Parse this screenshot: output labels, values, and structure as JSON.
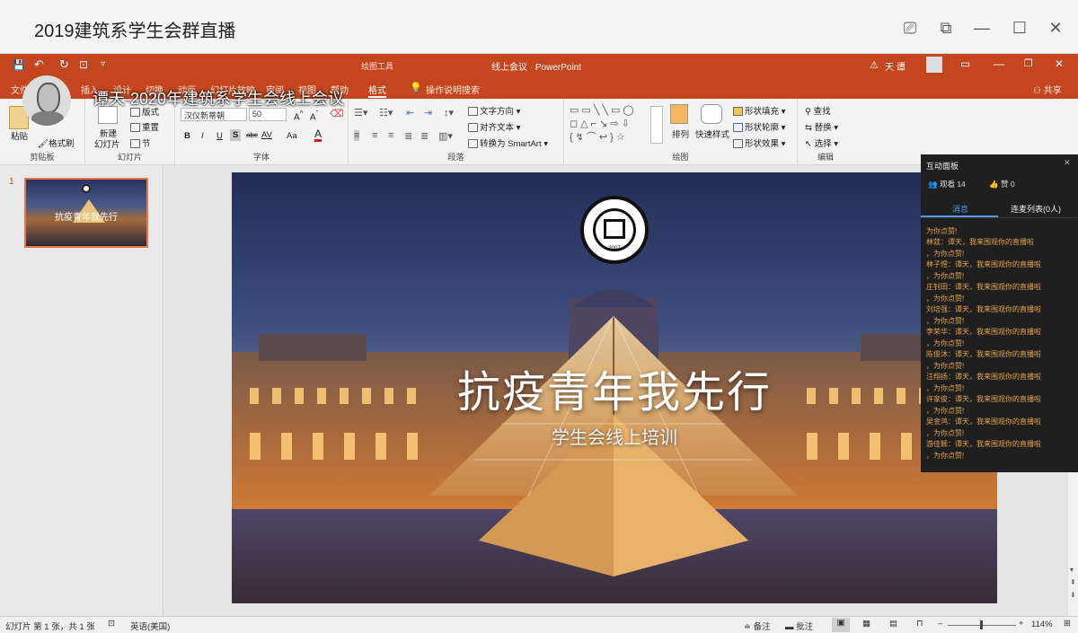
{
  "window": {
    "title": "2019建筑系学生会群直播"
  },
  "ppt": {
    "doc_title": "线上会议 · PowerPoint",
    "drawing_tools": "绘图工具",
    "user": "天 谭",
    "share": "共享",
    "tabs": [
      "文件",
      "插入",
      "设计",
      "切换",
      "动画",
      "幻灯片放映",
      "审阅",
      "视图",
      "帮助",
      "格式"
    ],
    "tell_me": "操作说明搜索"
  },
  "ribbon": {
    "clipboard": {
      "label": "剪贴板",
      "paste": "粘贴",
      "format_painter": "格式刷"
    },
    "slides": {
      "label": "幻灯片",
      "new_slide_line1": "新建",
      "new_slide_line2": "幻灯片",
      "layout": "版式",
      "reset": "重置",
      "section": "节"
    },
    "font": {
      "label": "字体",
      "font_name": "汉仪新蒂朝",
      "font_size": "50",
      "bold": "B",
      "italic": "I",
      "underline": "U",
      "shadow": "S",
      "strike": "abc",
      "spacing": "AV",
      "case": "Aa",
      "color": "A"
    },
    "paragraph": {
      "label": "段落",
      "text_direction": "文字方向",
      "align_text": "对齐文本",
      "smartart": "转换为 SmartArt"
    },
    "drawing": {
      "label": "绘图",
      "arrange": "排列",
      "quick_styles": "快速样式",
      "fill": "形状填充",
      "outline": "形状轮廓",
      "effects": "形状效果"
    },
    "editing": {
      "label": "编辑",
      "find": "查找",
      "replace": "替换",
      "select": "选择"
    }
  },
  "thumbnail": {
    "number": "1",
    "title": "抗疫青年我先行"
  },
  "slide": {
    "title": "抗疫青年我先行",
    "subtitle": "学生会线上培训",
    "logo_year": "2007"
  },
  "presenter": {
    "name": "谭天-2020年建筑系学生会线上会议"
  },
  "panel": {
    "title": "互动面板",
    "viewers": "观看 14",
    "likes": "赞 0",
    "tab_messages": "消息",
    "tab_connect": "连麦列表(0人)",
    "messages": [
      "为你点赞!",
      "林莛：谭天，我来围观你的直播啦",
      "，为你点赞!",
      "林子煜：谭天，我来围观你的直播啦",
      "，为你点赞!",
      "庄钊田：谭天，我来围观你的直播啦",
      "，为你点赞!",
      "刘培强：谭天，我来围观你的直播啦",
      "，为你点赞!",
      "李荣华：谭天，我来围观你的直播啦",
      "，为你点赞!",
      "陈俊沐：谭天，我来围观你的直播啦",
      "，为你点赞!",
      "汪翔扬：谭天，我来围观你的直播啦",
      "，为你点赞!",
      "许家俊：谭天，我来围观你的直播啦",
      "，为你点赞!",
      "吴金鸿：谭天，我来围观你的直播啦",
      "，为你点赞!",
      "游佳颖：谭天，我来围观你的直播啦",
      "，为你点赞!"
    ]
  },
  "status": {
    "slide_info": "幻灯片 第 1 张，共 1 张",
    "language": "英语(美国)",
    "notes": "备注",
    "comments": "批注",
    "zoom": "114%"
  },
  "colors": {
    "accent": "#c3461f",
    "panel_bg": "#1f1f1f",
    "panel_msg": "#e3a24b"
  }
}
